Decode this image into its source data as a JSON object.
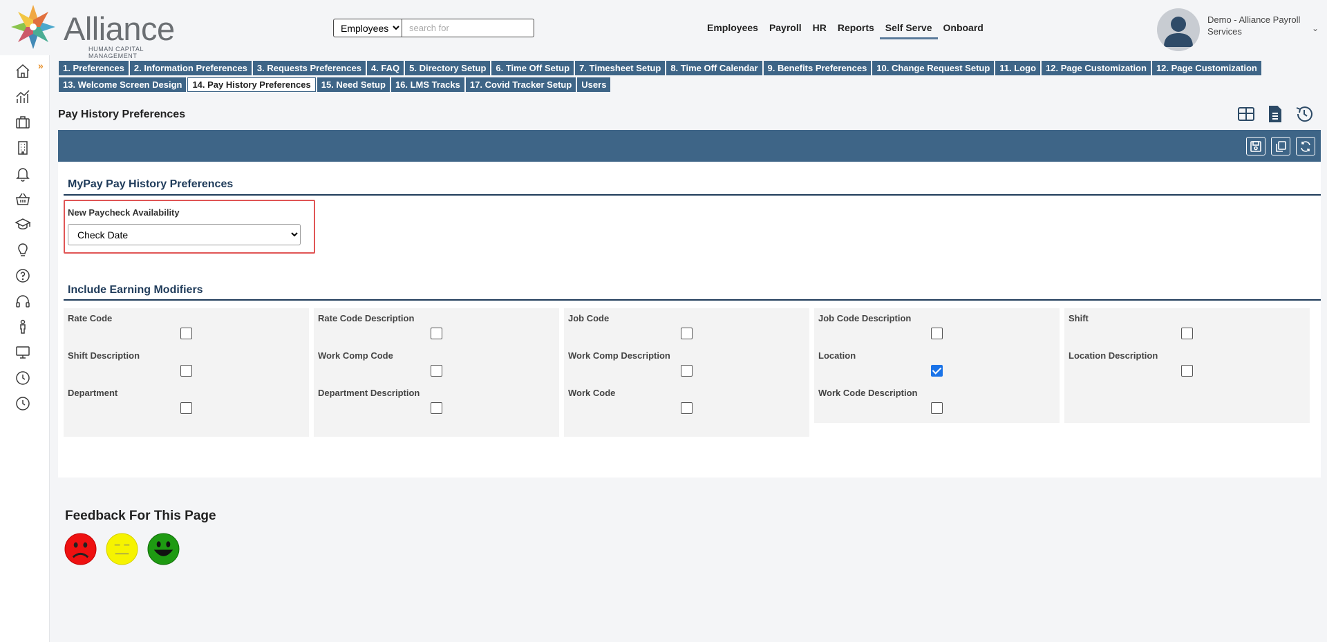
{
  "header": {
    "logo": {
      "name": "Alliance",
      "subtitle": "HUMAN CAPITAL MANAGEMENT"
    },
    "search": {
      "category": "Employees",
      "placeholder": "search for"
    },
    "nav": [
      {
        "label": "Employees",
        "active": false
      },
      {
        "label": "Payroll",
        "active": false
      },
      {
        "label": "HR",
        "active": false
      },
      {
        "label": "Reports",
        "active": false
      },
      {
        "label": "Self Serve",
        "active": true
      },
      {
        "label": "Onboard",
        "active": false
      }
    ],
    "user": {
      "name": "Demo - Alliance Payroll Services"
    }
  },
  "sidebar": {
    "icons": [
      "home-icon",
      "analytics-icon",
      "briefcase-icon",
      "building-icon",
      "bell-icon",
      "basket-icon",
      "graduation-cap-icon",
      "lightbulb-icon",
      "help-icon",
      "headset-icon",
      "person-icon",
      "monitor-icon",
      "clock-icon",
      "clock-icon-2"
    ]
  },
  "tabs": {
    "row1": [
      "1. Preferences",
      "2. Information Preferences",
      "3. Requests Preferences",
      "4. FAQ",
      "5. Directory Setup",
      "6. Time Off Setup",
      "7. Timesheet Setup",
      "8. Time Off Calendar",
      "9. Benefits Preferences",
      "10. Change Request Setup",
      "11. Logo",
      "12. Page Customization",
      "12. Page Customization"
    ],
    "row2": [
      "13. Welcome Screen Design",
      "14. Pay History Preferences",
      "15. Need Setup",
      "16. LMS Tracks",
      "17. Covid Tracker Setup",
      "Users"
    ],
    "active": "14. Pay History Preferences"
  },
  "page": {
    "title": "Pay History Preferences",
    "section1": {
      "heading": "MyPay Pay History Preferences",
      "field_label": "New Paycheck Availability",
      "field_value": "Check Date"
    },
    "section2": {
      "heading": "Include Earning Modifiers",
      "modifiers": [
        {
          "label": "Rate Code",
          "checked": false
        },
        {
          "label": "Rate Code Description",
          "checked": false
        },
        {
          "label": "Job Code",
          "checked": false
        },
        {
          "label": "Job Code Description",
          "checked": false
        },
        {
          "label": "Shift",
          "checked": false
        },
        {
          "label": "Shift Description",
          "checked": false
        },
        {
          "label": "Work Comp Code",
          "checked": false
        },
        {
          "label": "Work Comp Description",
          "checked": false
        },
        {
          "label": "Location",
          "checked": true
        },
        {
          "label": "Location Description",
          "checked": false
        },
        {
          "label": "Department",
          "checked": false
        },
        {
          "label": "Department Description",
          "checked": false
        },
        {
          "label": "Work Code",
          "checked": false
        },
        {
          "label": "Work Code Description",
          "checked": false
        }
      ]
    }
  },
  "feedback": {
    "title": "Feedback For This Page",
    "faces": [
      "sad-face-icon",
      "neutral-face-icon",
      "happy-face-icon"
    ]
  },
  "colors": {
    "accent": "#3e6587",
    "heading": "#1f3b5a",
    "highlight": "#e05555",
    "check": "#1a73e8"
  }
}
